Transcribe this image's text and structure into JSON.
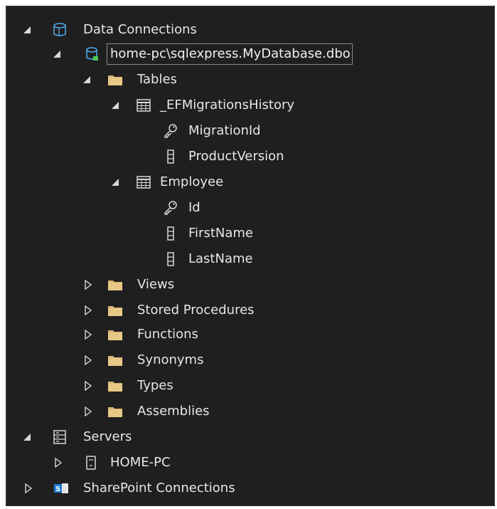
{
  "tree": {
    "data_connections": "Data Connections",
    "connection": "home-pc\\sqlexpress.MyDatabase.dbo",
    "tables": "Tables",
    "table1": {
      "name": "_EFMigrationsHistory",
      "columns": [
        "MigrationId",
        "ProductVersion"
      ]
    },
    "table2": {
      "name": "Employee",
      "columns": [
        "Id",
        "FirstName",
        "LastName"
      ]
    },
    "folders": [
      "Views",
      "Stored Procedures",
      "Functions",
      "Synonyms",
      "Types",
      "Assemblies"
    ],
    "servers": "Servers",
    "server": "HOME-PC",
    "sharepoint": "SharePoint Connections"
  },
  "icons": {
    "expanded": "expanded-triangle-icon",
    "collapsed": "collapsed-triangle-icon",
    "database": "database-icon",
    "connection": "database-connection-icon",
    "folder": "folder-icon",
    "table": "table-icon",
    "key": "key-icon",
    "column": "column-icon",
    "servers": "servers-icon",
    "server": "server-icon",
    "sharepoint": "sharepoint-icon"
  },
  "colors": {
    "background": "#1f1f1f",
    "text": "#e6e6e6",
    "folder": "#dcb67a",
    "connection_plug": "#4ec94e",
    "db": "#4ea6e8"
  }
}
